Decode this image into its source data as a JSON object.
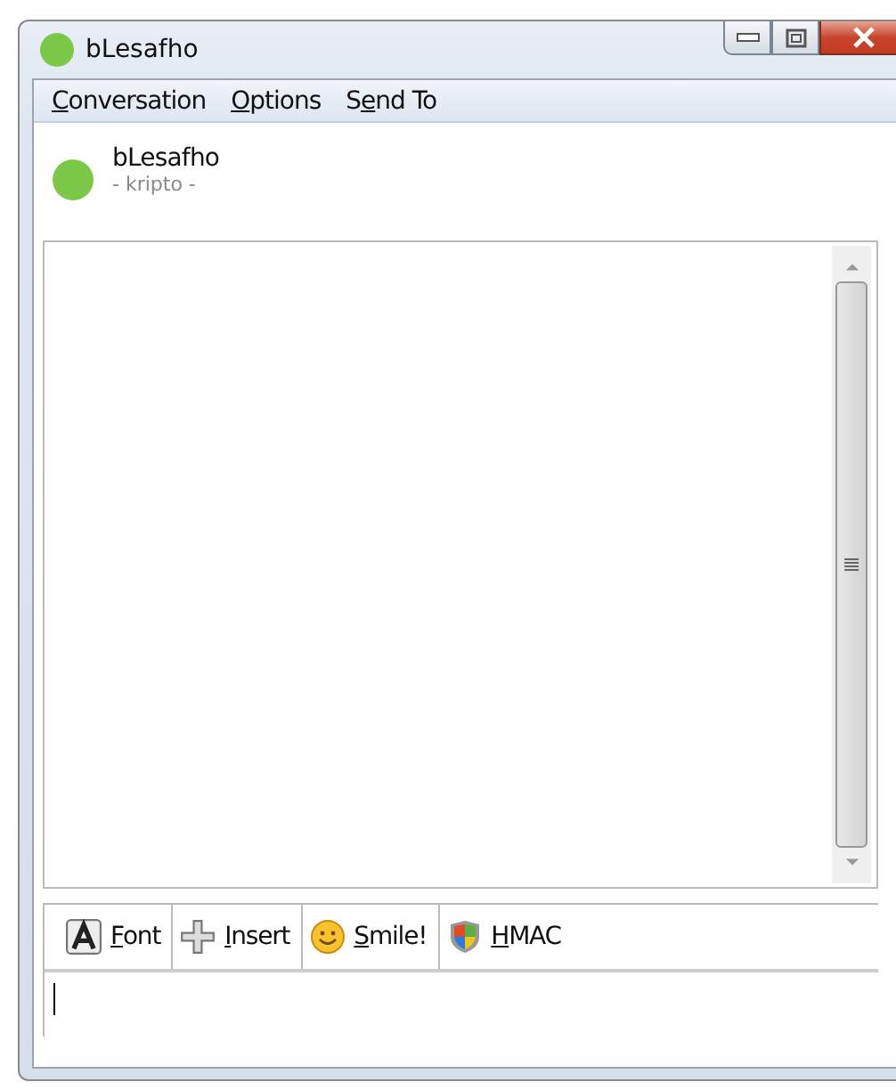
{
  "window": {
    "title": "bLesafho",
    "color": "#7cc94a"
  },
  "menu": [
    {
      "key": "C",
      "after": "onversation"
    },
    {
      "key": "O",
      "after": "ptions"
    },
    {
      "before": "S",
      "key": "e",
      "after": "nd To"
    }
  ],
  "contact": {
    "name": "bLesafho",
    "status_text": "- kripto -",
    "color": "#7cc94a"
  },
  "toolbar": [
    {
      "kind": "font",
      "key": "F",
      "after": "ont"
    },
    {
      "kind": "insert",
      "key": "I",
      "after": "nsert"
    },
    {
      "kind": "smile",
      "key": "S",
      "after": "mile!"
    },
    {
      "kind": "hmac",
      "key": "H",
      "after": "MAC"
    }
  ]
}
